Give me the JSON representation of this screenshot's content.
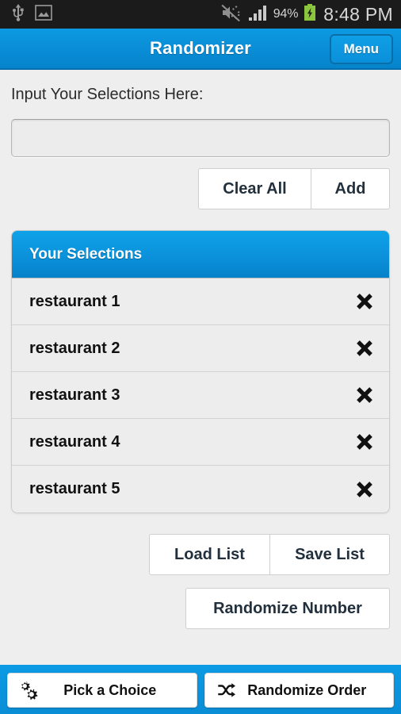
{
  "statusbar": {
    "icons": [
      "usb-icon",
      "image-icon",
      "mute-icon",
      "signal-icon"
    ],
    "battery_percent": "94%",
    "battery_state": "charging",
    "clock": "8:48 PM",
    "background": "#1b1b1b"
  },
  "actionbar": {
    "title": "Randomizer",
    "menu_label": "Menu",
    "accent": "#0a90da"
  },
  "main": {
    "input_label": "Input Your Selections Here:",
    "input_value": "",
    "input_placeholder": "",
    "clear_all_label": "Clear All",
    "add_label": "Add",
    "load_list_label": "Load List",
    "save_list_label": "Save List",
    "randomize_number_label": "Randomize Number"
  },
  "selections": {
    "header": "Your Selections",
    "delete_icon": "close-icon",
    "items": [
      {
        "label": "restaurant 1"
      },
      {
        "label": "restaurant 2"
      },
      {
        "label": "restaurant 3"
      },
      {
        "label": "restaurant 4"
      },
      {
        "label": "restaurant 5"
      }
    ]
  },
  "bottombar": {
    "pick_label": "Pick a Choice",
    "pick_icon": "gears-icon",
    "randomize_label": "Randomize Order",
    "randomize_icon": "shuffle-icon"
  }
}
